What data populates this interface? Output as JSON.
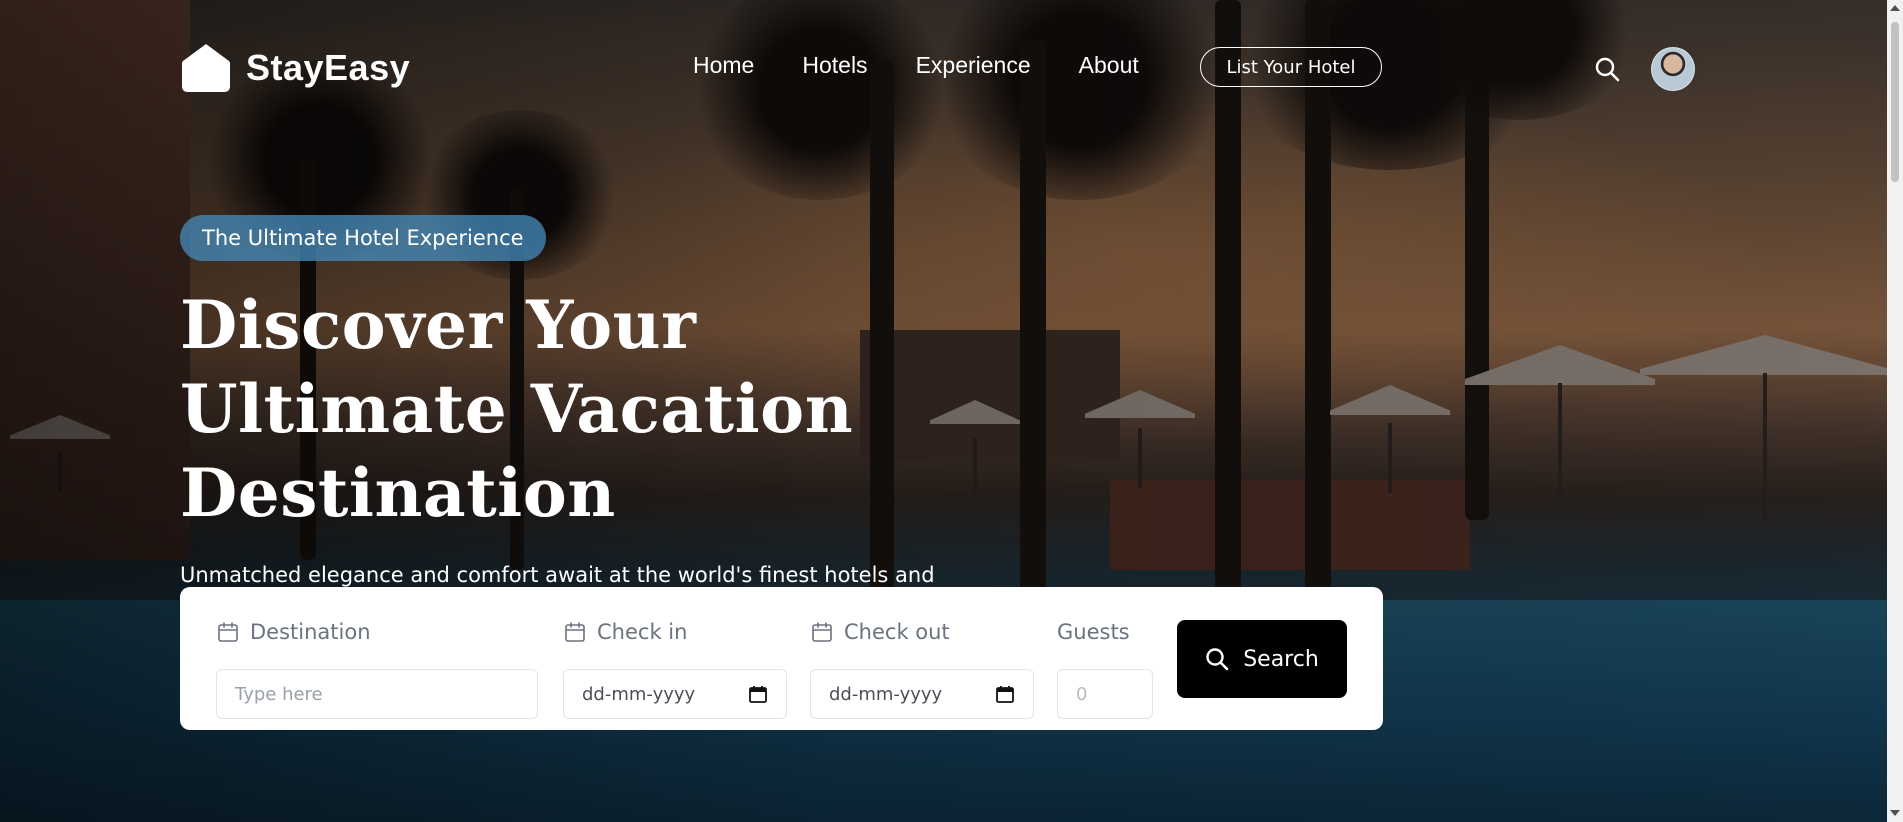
{
  "brand": {
    "name": "StayEasy",
    "logo_icon": "house-icon"
  },
  "nav": {
    "links": [
      "Home",
      "Hotels",
      "Experience",
      "About"
    ],
    "cta_label": "List Your Hotel",
    "search_icon": "search-icon",
    "avatar_icon": "user-avatar"
  },
  "hero": {
    "tagline": "The Ultimate Hotel Experience",
    "headline": "Discover Your Ultimate Vacation Destination",
    "subtext": "Unmatched elegance and comfort await at the world's finest hotels and resorts. Begin your journey today."
  },
  "search_form": {
    "destination": {
      "label": "Destination",
      "placeholder": "Type here",
      "icon": "calendar-icon"
    },
    "check_in": {
      "label": "Check in",
      "value": "dd-mm-yyyy",
      "icon": "calendar-icon"
    },
    "check_out": {
      "label": "Check out",
      "value": "dd-mm-yyyy",
      "icon": "calendar-icon"
    },
    "guests": {
      "label": "Guests",
      "placeholder": "0"
    },
    "button_label": "Search",
    "button_icon": "search-icon"
  },
  "colors": {
    "tagline_bg": "#468cbe",
    "card_bg": "#ffffff",
    "button_bg": "#000000",
    "label_text": "#6b7280"
  }
}
